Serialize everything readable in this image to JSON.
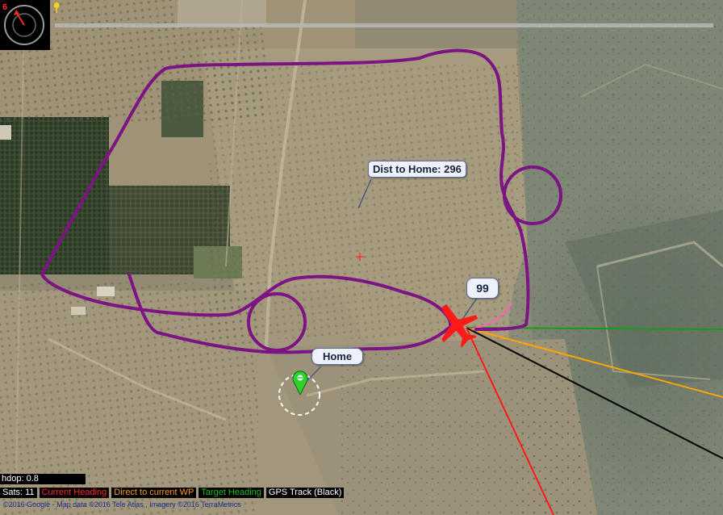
{
  "map": {
    "provider": "Google satellite",
    "colors": {
      "flight_path": "#7c1483",
      "current_heading": "#ff1a1a",
      "direct_to_wp": "#ffa500",
      "target_heading": "#1a9a1a",
      "gps_track": "#000000",
      "aircraft": "#ff1a1a"
    }
  },
  "compass": {
    "heading_label": "6",
    "icon": "compass-icon"
  },
  "labels": {
    "dist_to_home": "Dist to Home: 296",
    "waypoint": "99",
    "home": "Home"
  },
  "status": {
    "hdop": "hdop: 0.8",
    "sats": "Sats: 11",
    "legend_current_heading": "Current Heading",
    "legend_direct_wp": "Direct to current WP",
    "legend_target_heading": "Target Heading",
    "legend_gps_track": "GPS Track (Black)"
  },
  "copyright": "©2016 Google - Map data ©2016 Tele Atlas , Imagery ©2016 TerraMetrics"
}
